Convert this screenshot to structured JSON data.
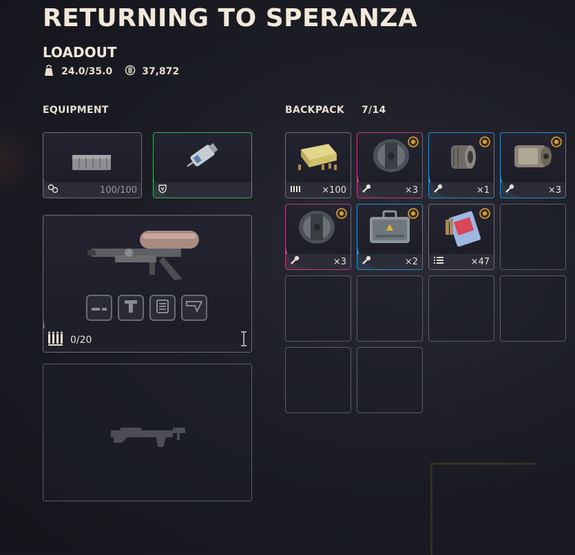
{
  "header": {
    "title": "RETURNING TO SPERANZA",
    "section": "LOADOUT"
  },
  "stats": {
    "weight": "24.0/35.0",
    "currency": "37,872"
  },
  "equipment": {
    "label": "EQUIPMENT",
    "slot_1": {
      "value": "100/100",
      "icon": "shield-recharge-icon"
    },
    "slot_2": {
      "icon": "shield-emblem-icon"
    },
    "weapon_1": {
      "ammo": "0/20",
      "attachments": [
        "muzzle-icon",
        "underbarrel-icon",
        "magazine-icon",
        "stock-icon"
      ]
    },
    "weapon_2": {
      "state": "empty"
    }
  },
  "backpack": {
    "label": "BACKPACK",
    "count": "7/14",
    "items": [
      {
        "name": "ammo-box",
        "qty": "×100",
        "icon": "ammo-icon"
      },
      {
        "name": "canister",
        "qty": "×3",
        "icon": "wrench-icon",
        "rarity": "#b8417f"
      },
      {
        "name": "gear-part",
        "qty": "×1",
        "icon": "wrench-icon",
        "rarity": "#2b8ccc"
      },
      {
        "name": "motor-part",
        "qty": "×3",
        "icon": "wrench-icon",
        "rarity": "#2b8ccc"
      },
      {
        "name": "canister",
        "qty": "×3",
        "icon": "wrench-icon",
        "rarity": "#b8417f"
      },
      {
        "name": "tool-case",
        "qty": "×2",
        "icon": "wrench-icon",
        "rarity": "#2b8ccc"
      },
      {
        "name": "bullet-pack",
        "qty": "×47",
        "icon": "list-icon"
      }
    ]
  },
  "colors": {
    "rarity_green": "#3da95a",
    "rarity_pink": "#b8417f",
    "rarity_blue": "#2b8ccc",
    "badge": "#d9a13a"
  }
}
